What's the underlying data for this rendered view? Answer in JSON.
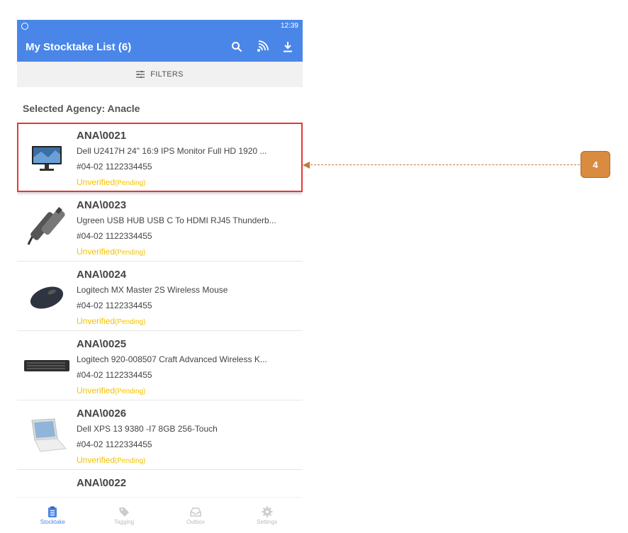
{
  "statusbar": {
    "time": "12:39"
  },
  "appbar": {
    "title": "My Stocktake List (6)"
  },
  "filters": {
    "label": "FILTERS"
  },
  "agency": {
    "label": "Selected Agency: Anacle"
  },
  "items": [
    {
      "code": "ANA\\0021",
      "desc": "Dell U2417H 24\" 16:9 IPS Monitor Full HD 1920 ...",
      "loc": "#04-02 1122334455",
      "status": "Unverified",
      "pending": "(Pending)"
    },
    {
      "code": "ANA\\0023",
      "desc": "Ugreen USB HUB USB C To HDMI RJ45 Thunderb...",
      "loc": "#04-02 1122334455",
      "status": "Unverified",
      "pending": "(Pending)"
    },
    {
      "code": "ANA\\0024",
      "desc": "Logitech MX Master 2S Wireless Mouse",
      "loc": "#04-02 1122334455",
      "status": "Unverified",
      "pending": "(Pending)"
    },
    {
      "code": "ANA\\0025",
      "desc": "Logitech 920-008507 Craft Advanced Wireless K...",
      "loc": "#04-02 1122334455",
      "status": "Unverified",
      "pending": "(Pending)"
    },
    {
      "code": "ANA\\0026",
      "desc": "Dell XPS 13 9380 -I7 8GB 256-Touch",
      "loc": "#04-02 1122334455",
      "status": "Unverified",
      "pending": "(Pending)"
    },
    {
      "code": "ANA\\0022"
    }
  ],
  "tabs": [
    {
      "label": "Stocktake"
    },
    {
      "label": "Tagging"
    },
    {
      "label": "Outbox"
    },
    {
      "label": "Settings"
    }
  ],
  "callout": {
    "number": "4"
  },
  "colors": {
    "primary": "#4a86e8",
    "status": "#f2c200",
    "highlight": "#e53935",
    "callout": "#d98b3f"
  }
}
